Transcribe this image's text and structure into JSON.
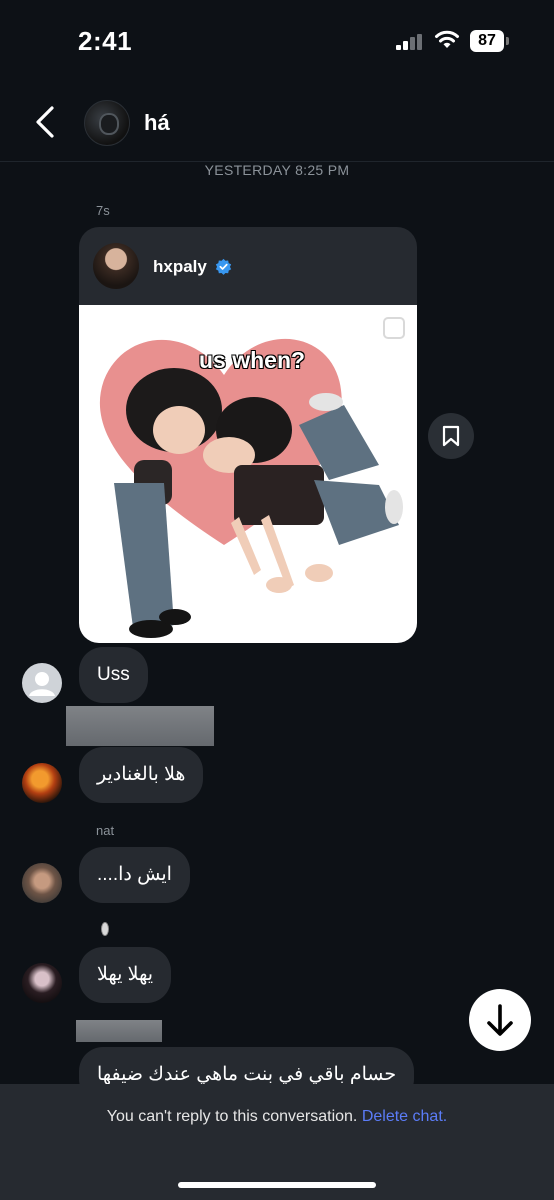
{
  "status_bar": {
    "time": "2:41",
    "battery": "87"
  },
  "header": {
    "name": "há"
  },
  "date_separator": "YESTERDAY 8:25 PM",
  "post": {
    "sender_label": "7s",
    "username": "hxpaly",
    "caption": "us when?"
  },
  "messages": [
    {
      "text": "Uss"
    },
    {
      "text": "هلا بالغنادير"
    },
    {
      "sender_label": "nat",
      "text": "ايش دا...."
    },
    {
      "text": "يهلا يهلا"
    },
    {
      "text": "حسام باقي في بنت ماهي عندك ضيفها"
    }
  ],
  "footer": {
    "notice": "You can't reply to this conversation.",
    "action": "Delete chat."
  },
  "icons": {
    "back": "chevron-left-icon",
    "verified": "verified-badge-icon",
    "save": "bookmark-icon",
    "scroll": "arrow-down-icon"
  },
  "colors": {
    "background": "#0d1116",
    "bubble": "#262a30",
    "link": "#5b7cf7",
    "verified": "#3897f0"
  }
}
